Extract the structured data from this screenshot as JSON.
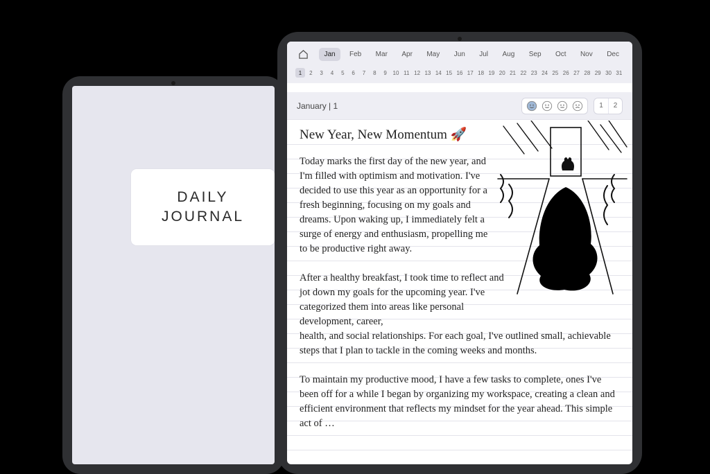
{
  "cover": {
    "line1": "DAILY",
    "line2": "JOURNAL"
  },
  "months": [
    "Jan",
    "Feb",
    "Mar",
    "Apr",
    "May",
    "Jun",
    "Jul",
    "Aug",
    "Sep",
    "Oct",
    "Nov",
    "Dec"
  ],
  "selected_month_index": 0,
  "days": [
    "1",
    "2",
    "3",
    "4",
    "5",
    "6",
    "7",
    "8",
    "9",
    "10",
    "11",
    "12",
    "13",
    "14",
    "15",
    "16",
    "17",
    "18",
    "19",
    "20",
    "21",
    "22",
    "23",
    "24",
    "25",
    "26",
    "27",
    "28",
    "29",
    "30",
    "31"
  ],
  "selected_day_index": 0,
  "header": {
    "date_label": "January | 1",
    "pages": [
      "1",
      "2"
    ],
    "selected_page_index": 0,
    "moods": [
      "happy",
      "content",
      "neutral",
      "sad"
    ],
    "selected_mood_index": 0
  },
  "entry": {
    "title": "New Year, New Momentum 🚀",
    "p1": "Today marks the first day of the new year, and I'm filled with optimism and motivation. I've decided to use this year as an opportunity for a fresh beginning, focusing on my goals and dreams. Upon waking up, I immediately felt a surge of energy and enthusiasm, propelling me to be productive right away.",
    "p2a": "After a healthy breakfast, I took time to reflect and jot down my goals for the upcoming year. I've categorized them into areas like personal development, career,",
    "p2b": "health, and social relationships. For each goal, I've outlined small, achievable steps that I plan to tackle in the coming weeks and months.",
    "p3": "To maintain my productive mood, I have a few tasks to complete, ones I've been off for a while I began by organizing my workspace, creating a clean and efficient environment that reflects my mindset for the year ahead. This simple act of …"
  }
}
